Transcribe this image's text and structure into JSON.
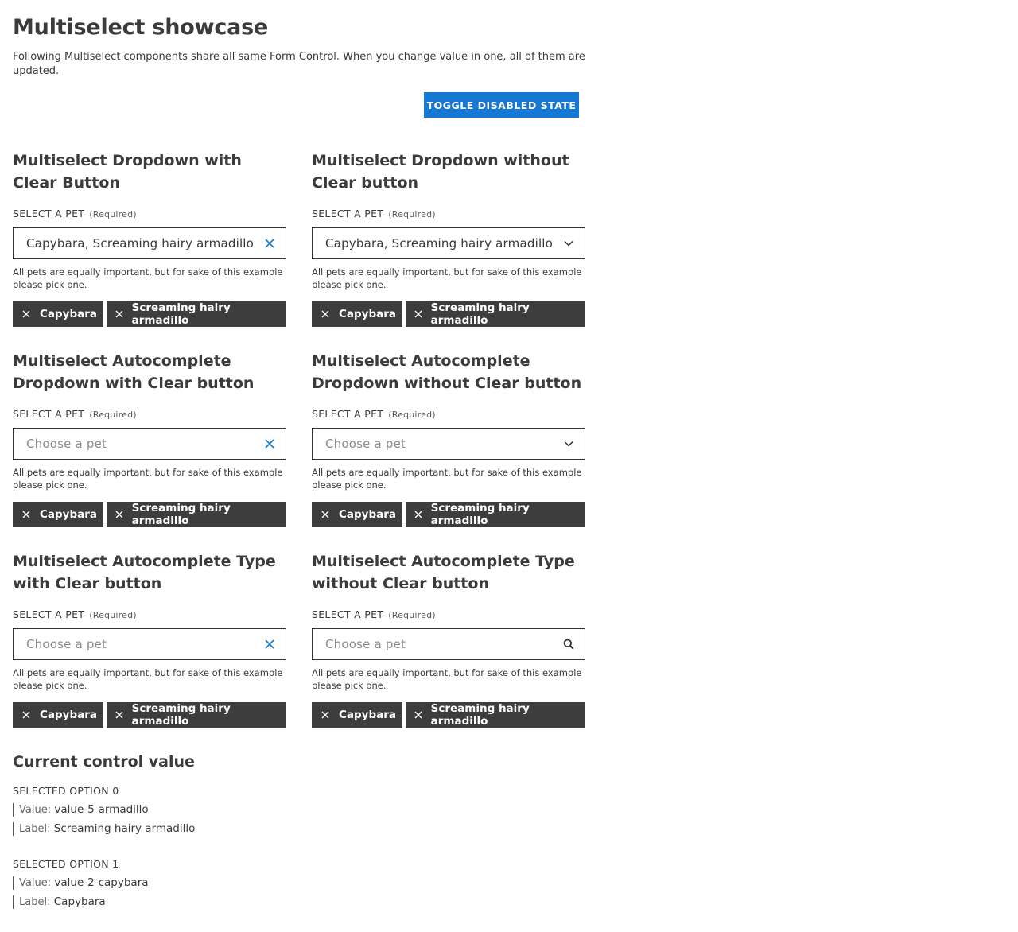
{
  "page": {
    "title": "Multiselect showcase",
    "intro": "Following Multiselect components share all same Form Control. When you change value in one, all of them are updated.",
    "toggle_label": "TOGGLE DISABLED STATE"
  },
  "demos": [
    {
      "title": "Multiselect Dropdown with Clear Button",
      "label": "SELECT A PET",
      "required": "(Required)",
      "value": "Capybara, Screaming hairy armadillo",
      "placeholder": "",
      "icon": "clear-icon",
      "help": "All pets are equally important, but for sake of this example please pick one.",
      "chips": [
        "Capybara",
        "Screaming hairy armadillo"
      ]
    },
    {
      "title": "Multiselect Dropdown without Clear button",
      "label": "SELECT A PET",
      "required": "(Required)",
      "value": "Capybara, Screaming hairy armadillo",
      "placeholder": "",
      "icon": "chevron-down-icon",
      "help": "All pets are equally important, but for sake of this example please pick one.",
      "chips": [
        "Capybara",
        "Screaming hairy armadillo"
      ]
    },
    {
      "title": "Multiselect Autocomplete Dropdown with Clear button",
      "label": "SELECT A PET",
      "required": "(Required)",
      "value": "",
      "placeholder": "Choose a pet",
      "icon": "clear-icon",
      "help": "All pets are equally important, but for sake of this example please pick one.",
      "chips": [
        "Capybara",
        "Screaming hairy armadillo"
      ]
    },
    {
      "title": "Multiselect Autocomplete Dropdown without Clear button",
      "label": "SELECT A PET",
      "required": "(Required)",
      "value": "",
      "placeholder": "Choose a pet",
      "icon": "chevron-down-icon",
      "help": "All pets are equally important, but for sake of this example please pick one.",
      "chips": [
        "Capybara",
        "Screaming hairy armadillo"
      ]
    },
    {
      "title": "Multiselect Autocomplete Type with Clear button",
      "label": "SELECT A PET",
      "required": "(Required)",
      "value": "",
      "placeholder": "Choose a pet",
      "icon": "clear-icon",
      "help": "All pets are equally important, but for sake of this example please pick one.",
      "chips": [
        "Capybara",
        "Screaming hairy armadillo"
      ]
    },
    {
      "title": "Multiselect Autocomplete Type without Clear button",
      "label": "SELECT A PET",
      "required": "(Required)",
      "value": "",
      "placeholder": "Choose a pet",
      "icon": "search-icon",
      "help": "All pets are equally important, but for sake of this example please pick one.",
      "chips": [
        "Capybara",
        "Screaming hairy armadillo"
      ]
    }
  ],
  "current": {
    "title": "Current control value",
    "value_key": "Value:",
    "label_key": "Label:",
    "options": [
      {
        "heading": "SELECTED OPTION 0",
        "value": "value-5-armadillo",
        "label": "Screaming hairy armadillo"
      },
      {
        "heading": "SELECTED OPTION 1",
        "value": "value-2-capybara",
        "label": "Capybara"
      }
    ]
  },
  "colors": {
    "accent": "#1478d4",
    "chip_bg": "#3d3d3d",
    "text": "#3a3a3a"
  }
}
